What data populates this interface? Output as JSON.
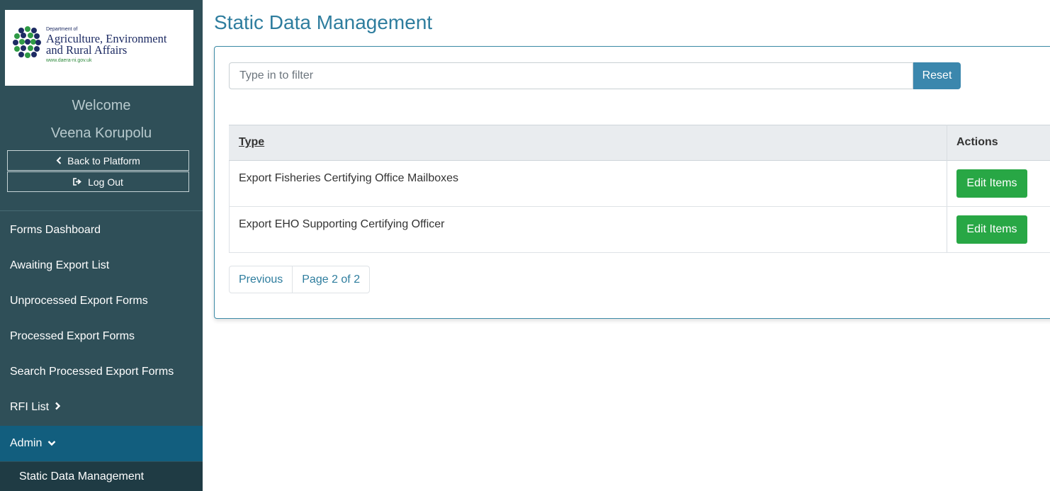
{
  "logo": {
    "dept_small": "Department of",
    "title_line1": "Agriculture, Environment",
    "title_line2": "and Rural Affairs",
    "url": "www.daera-ni.gov.uk"
  },
  "sidebar": {
    "welcome": "Welcome",
    "user_name": "Veena Korupolu",
    "back_label": "Back to Platform",
    "logout_label": "Log Out",
    "nav_items": [
      {
        "label": "Forms Dashboard"
      },
      {
        "label": "Awaiting Export List"
      },
      {
        "label": "Unprocessed Export Forms"
      },
      {
        "label": "Processed Export Forms"
      },
      {
        "label": "Search Processed Export Forms"
      },
      {
        "label": "RFI List"
      },
      {
        "label": "Admin"
      }
    ],
    "sub_item": "Static Data Management",
    "colors": {
      "background": "#2f4f58",
      "active": "#125e7e",
      "sub": "#1f3b44"
    }
  },
  "main": {
    "title": "Static Data Management",
    "filter_placeholder": "Type in to filter",
    "filter_value": "",
    "reset_label": "Reset",
    "table": {
      "headers": {
        "type": "Type",
        "actions": "Actions"
      },
      "rows": [
        {
          "type": "Export Fisheries Certifying Office Mailboxes",
          "action": "Edit Items"
        },
        {
          "type": "Export EHO Supporting Certifying Officer",
          "action": "Edit Items"
        }
      ]
    },
    "pagination": {
      "previous": "Previous",
      "info": "Page 2 of 2"
    }
  },
  "colors": {
    "accent": "#2e7d9e",
    "reset": "#3b87ad",
    "edit": "#28a745"
  }
}
